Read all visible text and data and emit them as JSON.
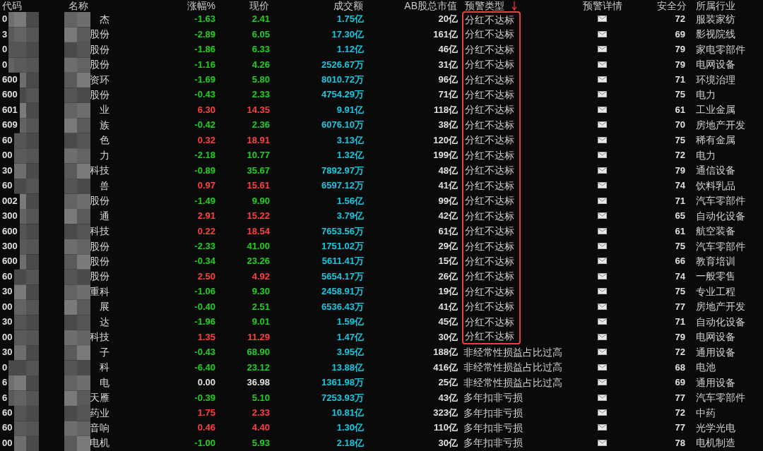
{
  "columns": [
    {
      "label": "代码",
      "sorted": false
    },
    {
      "label": "名称",
      "sorted": false
    },
    {
      "label": "涨幅%",
      "sorted": false
    },
    {
      "label": "现价",
      "sorted": false
    },
    {
      "label": "成交额",
      "sorted": false
    },
    {
      "label": "AB股总市值",
      "sorted": false
    },
    {
      "label": "预警类型",
      "sorted": true
    },
    {
      "label": "预警详情",
      "sorted": false
    },
    {
      "label": "安全分",
      "sorted": false
    },
    {
      "label": "所属行业",
      "sorted": false
    }
  ],
  "rows": [
    {
      "code": "0",
      "name": "杰",
      "change": "-1.63",
      "price": "2.41",
      "amount": "1.75亿",
      "market_cap": "20亿",
      "alert_type": "分红不达标",
      "score": "72",
      "industry": "服装家纺",
      "color": "#20d020",
      "marked": true
    },
    {
      "code": "3",
      "name": "股份",
      "change": "-2.89",
      "price": "6.05",
      "amount": "17.30亿",
      "market_cap": "161亿",
      "alert_type": "分红不达标",
      "score": "69",
      "industry": "影视院线",
      "color": "#20d020",
      "marked": true
    },
    {
      "code": "0",
      "name": "股份",
      "change": "-1.86",
      "price": "6.33",
      "amount": "1.12亿",
      "market_cap": "46亿",
      "alert_type": "分红不达标",
      "score": "79",
      "industry": "家电零部件",
      "color": "#20d020",
      "marked": true
    },
    {
      "code": "0",
      "name": "股份",
      "change": "-1.16",
      "price": "4.26",
      "amount": "2526.67万",
      "market_cap": "31亿",
      "alert_type": "分红不达标",
      "score": "79",
      "industry": "电网设备",
      "color": "#20d020",
      "marked": true
    },
    {
      "code": "600",
      "name": "资环",
      "change": "-1.69",
      "price": "5.80",
      "amount": "8010.72万",
      "market_cap": "96亿",
      "alert_type": "分红不达标",
      "score": "71",
      "industry": "环境治理",
      "color": "#20d020",
      "marked": true
    },
    {
      "code": "600",
      "name": "股份",
      "change": "-0.43",
      "price": "2.33",
      "amount": "4754.29万",
      "market_cap": "71亿",
      "alert_type": "分红不达标",
      "score": "75",
      "industry": "电力",
      "color": "#20d020",
      "marked": true
    },
    {
      "code": "601",
      "name": "业",
      "change": "6.30",
      "price": "14.35",
      "amount": "9.91亿",
      "market_cap": "118亿",
      "alert_type": "分红不达标",
      "score": "61",
      "industry": "工业金属",
      "color": "#ff4040",
      "marked": true
    },
    {
      "code": "609",
      "name": "族",
      "change": "-0.42",
      "price": "2.36",
      "amount": "6076.10万",
      "market_cap": "38亿",
      "alert_type": "分红不达标",
      "score": "70",
      "industry": "房地产开发",
      "color": "#20d020",
      "marked": true
    },
    {
      "code": "60",
      "name": "色",
      "change": "0.32",
      "price": "18.91",
      "amount": "3.13亿",
      "market_cap": "120亿",
      "alert_type": "分红不达标",
      "score": "75",
      "industry": "稀有金属",
      "color": "#ff4040",
      "marked": true
    },
    {
      "code": "00",
      "name": "力",
      "change": "-2.18",
      "price": "10.77",
      "amount": "1.32亿",
      "market_cap": "199亿",
      "alert_type": "分红不达标",
      "score": "72",
      "industry": "电力",
      "color": "#20d020",
      "marked": true
    },
    {
      "code": "30",
      "name": "科技",
      "change": "-0.89",
      "price": "35.67",
      "amount": "7892.97万",
      "market_cap": "48亿",
      "alert_type": "分红不达标",
      "score": "79",
      "industry": "通信设备",
      "color": "#20d020",
      "marked": true
    },
    {
      "code": "60",
      "name": "兽",
      "change": "0.97",
      "price": "15.61",
      "amount": "6597.12万",
      "market_cap": "41亿",
      "alert_type": "分红不达标",
      "score": "74",
      "industry": "饮料乳品",
      "color": "#ff4040",
      "marked": true
    },
    {
      "code": "002",
      "name": "股份",
      "change": "-1.49",
      "price": "9.90",
      "amount": "1.56亿",
      "market_cap": "99亿",
      "alert_type": "分红不达标",
      "score": "71",
      "industry": "汽车零部件",
      "color": "#20d020",
      "marked": true
    },
    {
      "code": "300",
      "name": "通",
      "change": "2.91",
      "price": "15.22",
      "amount": "3.79亿",
      "market_cap": "42亿",
      "alert_type": "分红不达标",
      "score": "65",
      "industry": "自动化设备",
      "color": "#ff4040",
      "marked": true
    },
    {
      "code": "600",
      "name": "科技",
      "change": "0.22",
      "price": "18.54",
      "amount": "7653.56万",
      "market_cap": "61亿",
      "alert_type": "分红不达标",
      "score": "61",
      "industry": "航空装备",
      "color": "#ff4040",
      "marked": true
    },
    {
      "code": "300",
      "name": "股份",
      "change": "-2.33",
      "price": "41.00",
      "amount": "1751.02万",
      "market_cap": "29亿",
      "alert_type": "分红不达标",
      "score": "75",
      "industry": "汽车零部件",
      "color": "#20d020",
      "marked": true
    },
    {
      "code": "600",
      "name": "股份",
      "change": "-0.34",
      "price": "23.26",
      "amount": "5611.41万",
      "market_cap": "15亿",
      "alert_type": "分红不达标",
      "score": "66",
      "industry": "教育培训",
      "color": "#20d020",
      "marked": true
    },
    {
      "code": "60",
      "name": "股份",
      "change": "2.50",
      "price": "4.92",
      "amount": "5654.17万",
      "market_cap": "26亿",
      "alert_type": "分红不达标",
      "score": "74",
      "industry": "一般零售",
      "color": "#ff4040",
      "marked": true
    },
    {
      "code": "30",
      "name": "重科",
      "change": "-1.06",
      "price": "9.30",
      "amount": "2458.91万",
      "market_cap": "19亿",
      "alert_type": "分红不达标",
      "score": "75",
      "industry": "专业工程",
      "color": "#20d020",
      "marked": true
    },
    {
      "code": "00",
      "name": "展",
      "change": "-0.40",
      "price": "2.51",
      "amount": "6536.43万",
      "market_cap": "41亿",
      "alert_type": "分红不达标",
      "score": "77",
      "industry": "房地产开发",
      "color": "#20d020",
      "marked": true
    },
    {
      "code": "30",
      "name": "达",
      "change": "-1.96",
      "price": "9.01",
      "amount": "1.59亿",
      "market_cap": "45亿",
      "alert_type": "分红不达标",
      "score": "71",
      "industry": "自动化设备",
      "color": "#20d020",
      "marked": true
    },
    {
      "code": "00",
      "name": "科技",
      "change": "1.35",
      "price": "11.29",
      "amount": "1.47亿",
      "market_cap": "30亿",
      "alert_type": "分红不达标",
      "score": "79",
      "industry": "电网设备",
      "color": "#ff4040",
      "marked": true
    },
    {
      "code": "30",
      "name": "子",
      "change": "-0.43",
      "price": "68.90",
      "amount": "3.95亿",
      "market_cap": "188亿",
      "alert_type": "非经常性损益占比过高",
      "score": "72",
      "industry": "通用设备",
      "color": "#20d020",
      "marked": false
    },
    {
      "code": "0",
      "name": "科",
      "change": "-6.40",
      "price": "23.12",
      "amount": "13.88亿",
      "market_cap": "416亿",
      "alert_type": "非经常性损益占比过高",
      "score": "68",
      "industry": "电池",
      "color": "#20d020",
      "marked": false
    },
    {
      "code": "6",
      "name": "电",
      "change": "0.00",
      "price": "36.98",
      "amount": "1361.98万",
      "market_cap": "25亿",
      "alert_type": "非经常性损益占比过高",
      "score": "69",
      "industry": "通用设备",
      "color": "#e0e0e0",
      "marked": false
    },
    {
      "code": "6",
      "name": "天雁",
      "change": "-0.39",
      "price": "5.10",
      "amount": "7253.93万",
      "market_cap": "43亿",
      "alert_type": "多年扣非亏损",
      "score": "77",
      "industry": "汽车零部件",
      "color": "#20d020",
      "marked": false
    },
    {
      "code": "60",
      "name": "药业",
      "change": "1.75",
      "price": "2.33",
      "amount": "10.81亿",
      "market_cap": "323亿",
      "alert_type": "多年扣非亏损",
      "score": "72",
      "industry": "中药",
      "color": "#ff4040",
      "marked": false
    },
    {
      "code": "60",
      "name": "音响",
      "change": "0.46",
      "price": "4.40",
      "amount": "1.30亿",
      "market_cap": "110亿",
      "alert_type": "多年扣非亏损",
      "score": "77",
      "industry": "光学光电",
      "color": "#ff4040",
      "marked": false
    },
    {
      "code": "00",
      "name": "电机",
      "change": "-1.00",
      "price": "5.93",
      "amount": "2.18亿",
      "market_cap": "30亿",
      "alert_type": "多年扣非亏损",
      "score": "78",
      "industry": "电机制造",
      "color": "#20d020",
      "marked": false
    }
  ]
}
